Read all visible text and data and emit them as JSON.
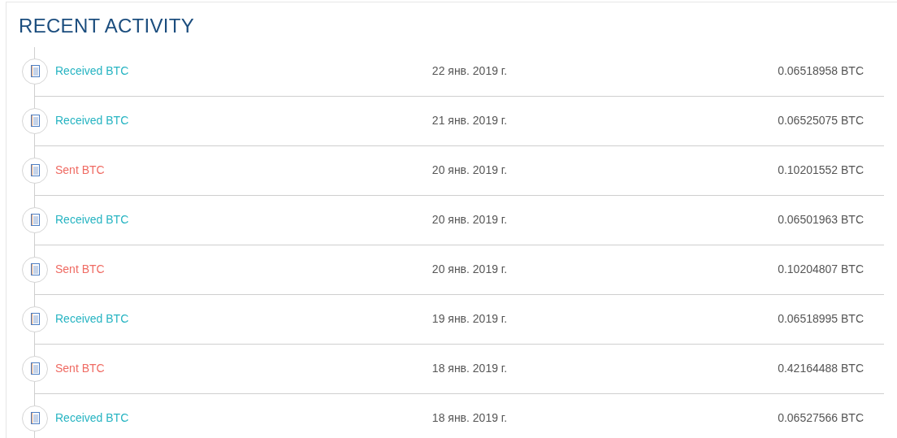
{
  "title": "RECENT ACTIVITY",
  "transactions": [
    {
      "kind": "received",
      "label": "Received BTC",
      "date": "22 янв. 2019 г.",
      "amount": "0.06518958 BTC"
    },
    {
      "kind": "received",
      "label": "Received BTC",
      "date": "21 янв. 2019 г.",
      "amount": "0.06525075 BTC"
    },
    {
      "kind": "sent",
      "label": "Sent BTC",
      "date": "20 янв. 2019 г.",
      "amount": "0.10201552 BTC"
    },
    {
      "kind": "received",
      "label": "Received BTC",
      "date": "20 янв. 2019 г.",
      "amount": "0.06501963 BTC"
    },
    {
      "kind": "sent",
      "label": "Sent BTC",
      "date": "20 янв. 2019 г.",
      "amount": "0.10204807 BTC"
    },
    {
      "kind": "received",
      "label": "Received BTC",
      "date": "19 янв. 2019 г.",
      "amount": "0.06518995 BTC"
    },
    {
      "kind": "sent",
      "label": "Sent BTC",
      "date": "18 янв. 2019 г.",
      "amount": "0.42164488 BTC"
    },
    {
      "kind": "received",
      "label": "Received BTC",
      "date": "18 янв. 2019 г.",
      "amount": "0.06527566 BTC"
    }
  ]
}
